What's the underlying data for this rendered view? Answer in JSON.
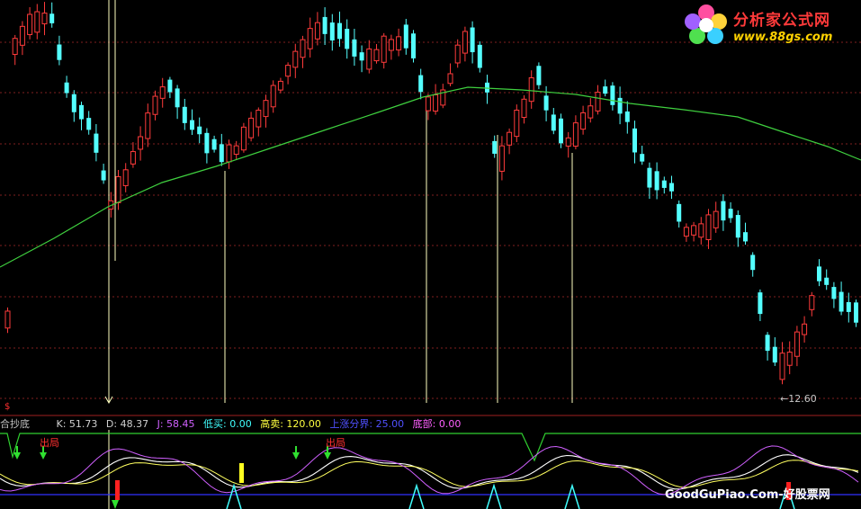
{
  "chart_data": {
    "type": "candlestick",
    "low_marker": "←12.60",
    "indicator": {
      "name": "合抄底",
      "fields": [
        {
          "label": "K: 51.73",
          "color": "#d0d0d0"
        },
        {
          "label": "D: 48.37",
          "color": "#d0d0d0"
        },
        {
          "label": "J: 58.45",
          "color": "#d060ff"
        },
        {
          "label": "低买: 0.00",
          "color": "#40ffff"
        },
        {
          "label": "高卖: 120.00",
          "color": "#ffff40"
        },
        {
          "label": "上涨分界: 25.00",
          "color": "#5050ff"
        },
        {
          "label": "底部: 0.00",
          "color": "#ff60ff"
        }
      ],
      "exit_label": "出局",
      "dollar": "$"
    }
  },
  "brand": {
    "title": "分析家公式网",
    "url": "www.88gs.com",
    "watermark": "GoodGuPiao.Com-好股票网"
  },
  "colors": {
    "up": "#ff3b3b",
    "down": "#54ffff",
    "ma": "#3fd03f",
    "signal_line": "#ffffc0",
    "grid": "#802020"
  }
}
